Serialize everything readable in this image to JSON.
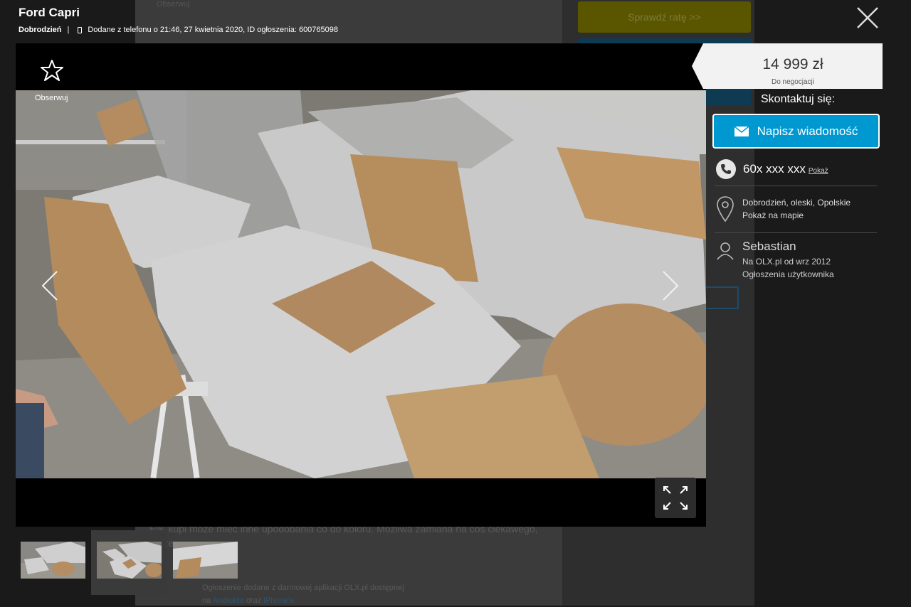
{
  "listing": {
    "title": "Ford Capri",
    "location": "Dobrodzień",
    "separator": "|",
    "added_info": "Dodane z telefonu o 21:46, 27 kwietnia 2020, ID ogłoszenia: 600765098"
  },
  "gallery": {
    "follow_label": "Obserwuj",
    "current_index": 2,
    "thumbnail_count": 3
  },
  "price": {
    "value": "14 999 zł",
    "negotiation": "Do negocjacji"
  },
  "contact": {
    "title": "Skontaktuj się:",
    "message_button": "Napisz wiadomość",
    "phone_masked": "60x xxx xxx",
    "show_phone": "Pokaż",
    "location_line": "Dobrodzień, oleski, Opolskie",
    "map_link": "Pokaż na mapie",
    "seller_name": "Sebastian",
    "seller_since": "Na OLX.pl od wrz 2012",
    "seller_ads": "Ogłoszenia użytkownika"
  },
  "background": {
    "installment_button": "Sprawdź ratę >>",
    "follow_label": "Obserwuj",
    "description": "Ew. kupi może mieć inne upodobania co do koloru. Możliwa zamiana na coś ciekawego, może",
    "app_note": "Ogłoszenie dodane z darmowej aplikacji OLX.pl dostępnej",
    "app_note_prefix": "na",
    "android_link": "Androida",
    "app_note_mid": "oraz",
    "iphone_link": "iPhone'a"
  },
  "colors": {
    "message_button": "#0098d0",
    "price_tag": "#f2f2f2",
    "overlay_background": "#1a1a1a"
  },
  "icons": {
    "close": "close-icon",
    "favorite": "star-outline-icon",
    "prev": "chevron-left-icon",
    "next": "chevron-right-icon",
    "fullscreen": "expand-icon",
    "message": "envelope-icon",
    "phone": "phone-icon",
    "location": "map-pin-icon",
    "user": "user-icon"
  }
}
